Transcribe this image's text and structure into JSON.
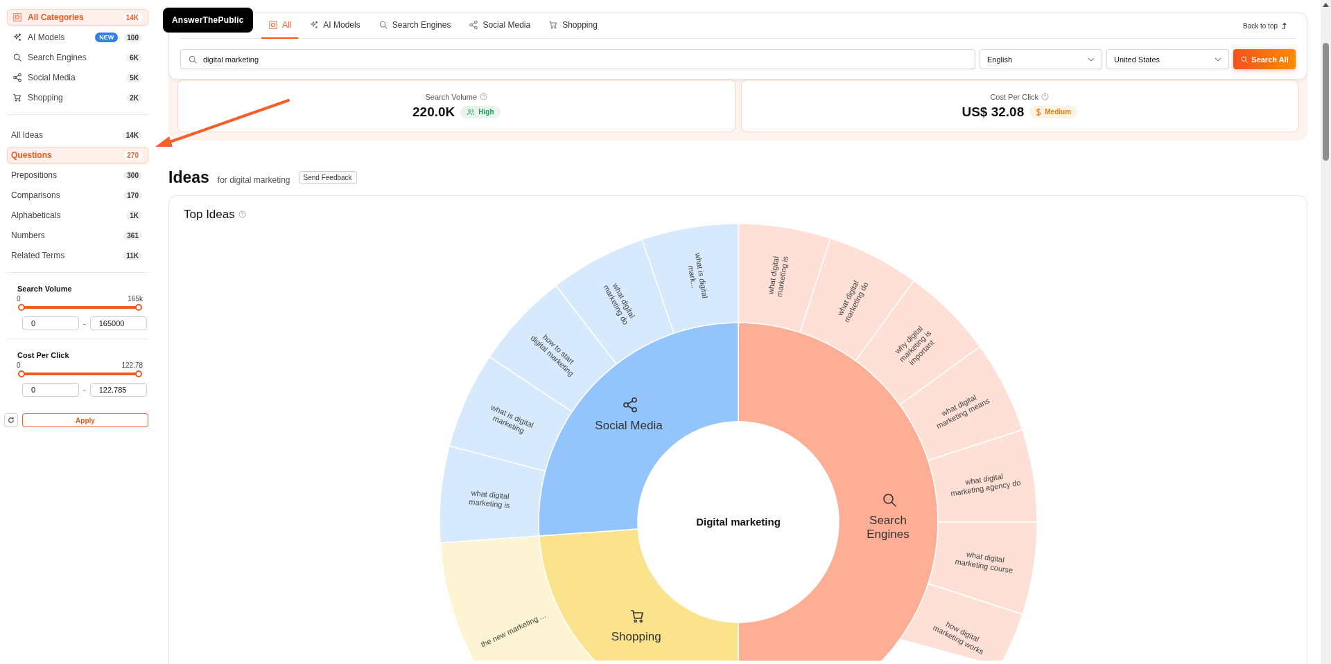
{
  "sidebar": {
    "categories": [
      {
        "kind": "all",
        "label": "All Categories",
        "count": "14K",
        "selected": true
      },
      {
        "kind": "ai",
        "label": "AI Models",
        "badge": "NEW",
        "count": "100",
        "selected": false
      },
      {
        "kind": "search",
        "label": "Search Engines",
        "count": "6K",
        "selected": false
      },
      {
        "kind": "social",
        "label": "Social Media",
        "count": "5K",
        "selected": false
      },
      {
        "kind": "shopping",
        "label": "Shopping",
        "count": "2K",
        "selected": false
      }
    ],
    "idea_types": [
      {
        "label": "All Ideas",
        "count": "14K",
        "selected": false
      },
      {
        "label": "Questions",
        "count": "270",
        "selected": true
      },
      {
        "label": "Prepositions",
        "count": "300",
        "selected": false
      },
      {
        "label": "Comparisons",
        "count": "170",
        "selected": false
      },
      {
        "label": "Alphabeticals",
        "count": "1K",
        "selected": false
      },
      {
        "label": "Numbers",
        "count": "361",
        "selected": false
      },
      {
        "label": "Related Terms",
        "count": "11K",
        "selected": false
      }
    ],
    "filters": [
      {
        "title": "Search Volume",
        "min_label": "0",
        "max_label": "165k",
        "level": 1,
        "min_value": "0",
        "separator": "-",
        "max_value": "165000"
      },
      {
        "title": "Cost Per Click",
        "min_label": "0",
        "max_label": "122.78",
        "level": 1,
        "min_value": "0",
        "separator": "-",
        "max_value": "122.785"
      }
    ],
    "apply_button": "Apply"
  },
  "header": {
    "logo": "AnswerThePublic",
    "tabs": [
      {
        "kind": "all",
        "label": "All",
        "selected": true
      },
      {
        "kind": "ai",
        "label": "AI Models",
        "selected": false
      },
      {
        "kind": "search",
        "label": "Search Engines",
        "selected": false
      },
      {
        "kind": "social",
        "label": "Social Media",
        "selected": false
      },
      {
        "kind": "shopping",
        "label": "Shopping",
        "selected": false
      }
    ],
    "back_to_top": "Back to top",
    "search": {
      "value": "digital marketing"
    },
    "language": "English",
    "country": "United States",
    "search_button": "Search All"
  },
  "metrics": [
    {
      "kind": "audience",
      "title": "Search Volume",
      "value": "220.0K",
      "badge": "High",
      "color": "#1a9a5c"
    },
    {
      "kind": "cost",
      "title": "Cost Per Click",
      "value": "US$ 32.08",
      "badge": "Medium",
      "color": "#e67e00"
    }
  ],
  "ideas": {
    "title": "Ideas",
    "subtitle": "for digital marketing",
    "feedback_button": "Send Feedback",
    "top_ideas": {
      "title": "Top Ideas",
      "center": "Digital marketing",
      "groups": [
        {
          "kind": "search",
          "label": "Search Engines",
          "color": "#fdae94",
          "children": [
            {
              "label": "what digital marketing is"
            },
            {
              "label": "what digital marketing do"
            },
            {
              "label": "why digital marketing is important"
            },
            {
              "label": "what digital marketing means"
            },
            {
              "label": "what digital marketing agency do"
            },
            {
              "label": "what digital marketing course"
            },
            {
              "label": "how digital marketing works"
            }
          ]
        },
        {
          "kind": "shopping",
          "label": "Shopping",
          "color": "#fbe38e",
          "children": [
            {
              "label": "the new marketing ..."
            }
          ]
        },
        {
          "kind": "social",
          "label": "Social Media",
          "color": "#93c4fb",
          "children": [
            {
              "label": "what digital marketing is"
            },
            {
              "label": "what is digital marketing"
            },
            {
              "label": "how to start digital marketing"
            },
            {
              "label": "what digital marketing do"
            },
            {
              "label": "what is digital mark..."
            }
          ]
        }
      ]
    }
  }
}
